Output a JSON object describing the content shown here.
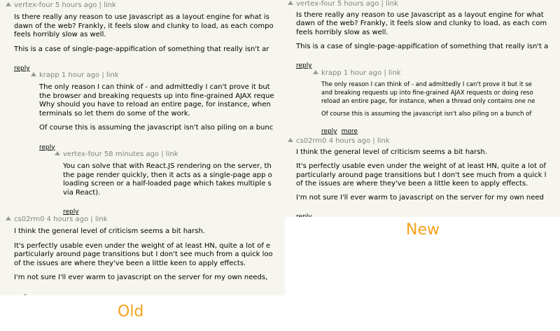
{
  "old": {
    "caption": "Old",
    "comments": [
      {
        "user": "vertex-four",
        "age": "5 hours ago",
        "link": "link",
        "paragraphs": [
          "Is there really any reason to use Javascript as a layout engine for what is",
          "dawn of the web? Frankly, it feels slow and clunky to load, as each compo",
          "feels horribly slow as well.",
          "This is a case of single-page-appification of something that really isn't ar"
        ],
        "reply": "reply"
      },
      {
        "user": "krapp",
        "age": "1 hour ago",
        "link": "link",
        "paragraphs": [
          "The only reason I can think of - and admittedly I can't prove it but",
          "the browser and breaking requests up into fine-grained AJAX reque",
          "Why should you have to reload an entire page, for instance, when",
          "terminals so let them do some of the work.",
          "Of course this is assuming the javascript isn't also piling on a bunc"
        ],
        "reply": "reply"
      },
      {
        "user": "vertex-four",
        "age": "58 minutes ago",
        "link": "link",
        "paragraphs": [
          "You can solve that with React.JS rendering on the server, th",
          "the page render quickly, then it acts as a single-page app o",
          "loading screen or a half-loaded page which takes multiple s",
          "via React)."
        ],
        "reply": "reply"
      },
      {
        "user": "cs02rm0",
        "age": "4 hours ago",
        "link": "link",
        "paragraphs": [
          "I think the general level of criticism seems a bit harsh.",
          "It's perfectly usable even under the weight of at least HN, quite a lot of e",
          "particularly around page transitions but I don't see much from a quick loo",
          "of the issues are where they've been a little keen to apply effects.",
          "I'm not sure I'll ever warm to javascript on the server for my own needs,"
        ],
        "reply": "reply"
      }
    ]
  },
  "new": {
    "caption": "New",
    "comments": [
      {
        "user": "vertex-four",
        "age": "5 hours ago",
        "link": "link",
        "paragraphs": [
          "Is there really any reason to use Javascript as a layout engine for what",
          "dawn of the web? Frankly, it feels slow and clunky to load, as each com",
          "feels horribly slow as well.",
          "This is a case of single-page-appification of something that really isn't a"
        ],
        "reply": "reply"
      },
      {
        "user": "krapp",
        "age": "1 hour ago",
        "link": "link",
        "paragraphs": [
          "The only reason I can think of - and admittedly I can't prove it but it se",
          "and breaking requests up into fine-grained AJAX requests or doing reso",
          "reload an entire page, for instance, when a thread only contains one ne",
          "Of course this is assuming the javascript isn't also piling on a bunch of"
        ],
        "reply": "reply",
        "more": "more"
      },
      {
        "user": "cs02rm0",
        "age": "4 hours ago",
        "link": "link",
        "paragraphs": [
          "I think the general level of criticism seems a bit harsh.",
          "It's perfectly usable even under the weight of at least HN, quite a lot of",
          "particularly around page transitions but I don't see much from a quick l",
          "of the issues are where they've been a little keen to apply effects.",
          "I'm not sure I'll ever warm to javascript on the server for my own need"
        ],
        "reply": "reply"
      }
    ]
  },
  "colors": {
    "background": "#f6f6ef",
    "meta": "#828282",
    "caption": "#f4a21c"
  }
}
